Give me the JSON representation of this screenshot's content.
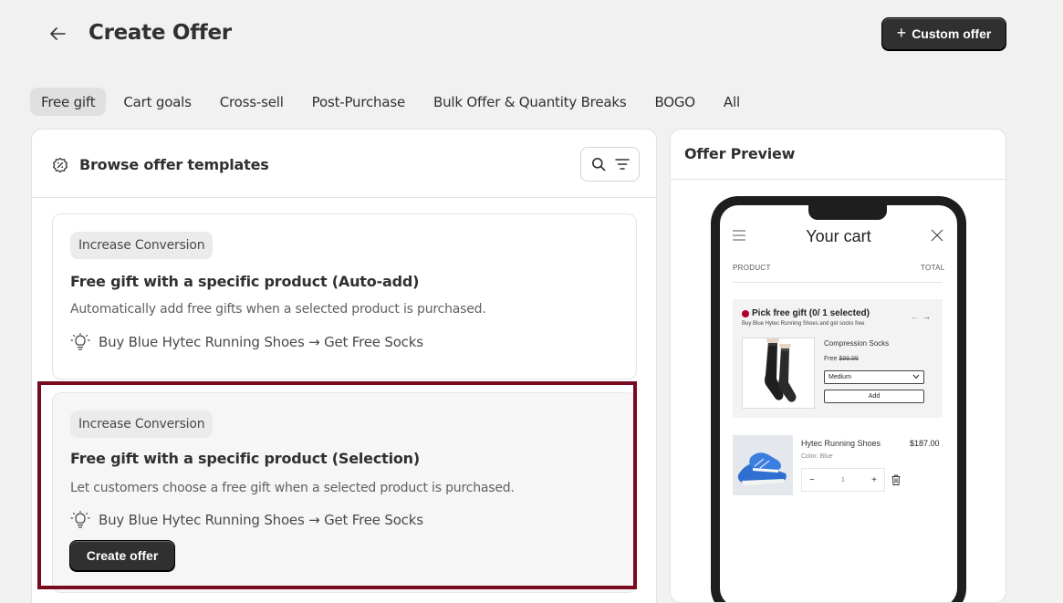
{
  "header": {
    "title": "Create Offer",
    "custom_offer_label": "Custom offer"
  },
  "tabs": [
    {
      "label": "Free gift",
      "active": true
    },
    {
      "label": "Cart goals"
    },
    {
      "label": "Cross-sell"
    },
    {
      "label": "Post-Purchase"
    },
    {
      "label": "Bulk Offer & Quantity Breaks"
    },
    {
      "label": "BOGO"
    },
    {
      "label": "All"
    }
  ],
  "browse": {
    "title": "Browse offer templates"
  },
  "templates": [
    {
      "badge": "Increase Conversion",
      "title": "Free gift with a specific product (Auto-add)",
      "description": "Automatically add free gifts when a selected product is purchased.",
      "example": "Buy Blue Hytec Running Shoes → Get Free Socks"
    },
    {
      "badge": "Increase Conversion",
      "title": "Free gift with a specific product (Selection)",
      "description": "Let customers choose a free gift when a selected product is purchased.",
      "example": "Buy Blue Hytec Running Shoes → Get Free Socks",
      "button": "Create offer"
    }
  ],
  "preview": {
    "title": "Offer Preview",
    "cart_title": "Your cart",
    "col_product": "PRODUCT",
    "col_total": "TOTAL",
    "gift": {
      "heading": "Pick free gift (0/ 1 selected)",
      "sub": "Buy Blue Hytec Running Shoes and get socks free",
      "name": "Compression Socks",
      "free_label": "Free",
      "orig_price": "$99.99",
      "size": "Medium",
      "add_label": "Add"
    },
    "item": {
      "name": "Hytec Running Shoes",
      "color": "Color: Blue",
      "price": "$187.00",
      "qty": "1"
    }
  },
  "colors": {
    "primary_button": "#303030",
    "highlight_border": "#7a0a1e",
    "background": "#f1f1f1"
  }
}
